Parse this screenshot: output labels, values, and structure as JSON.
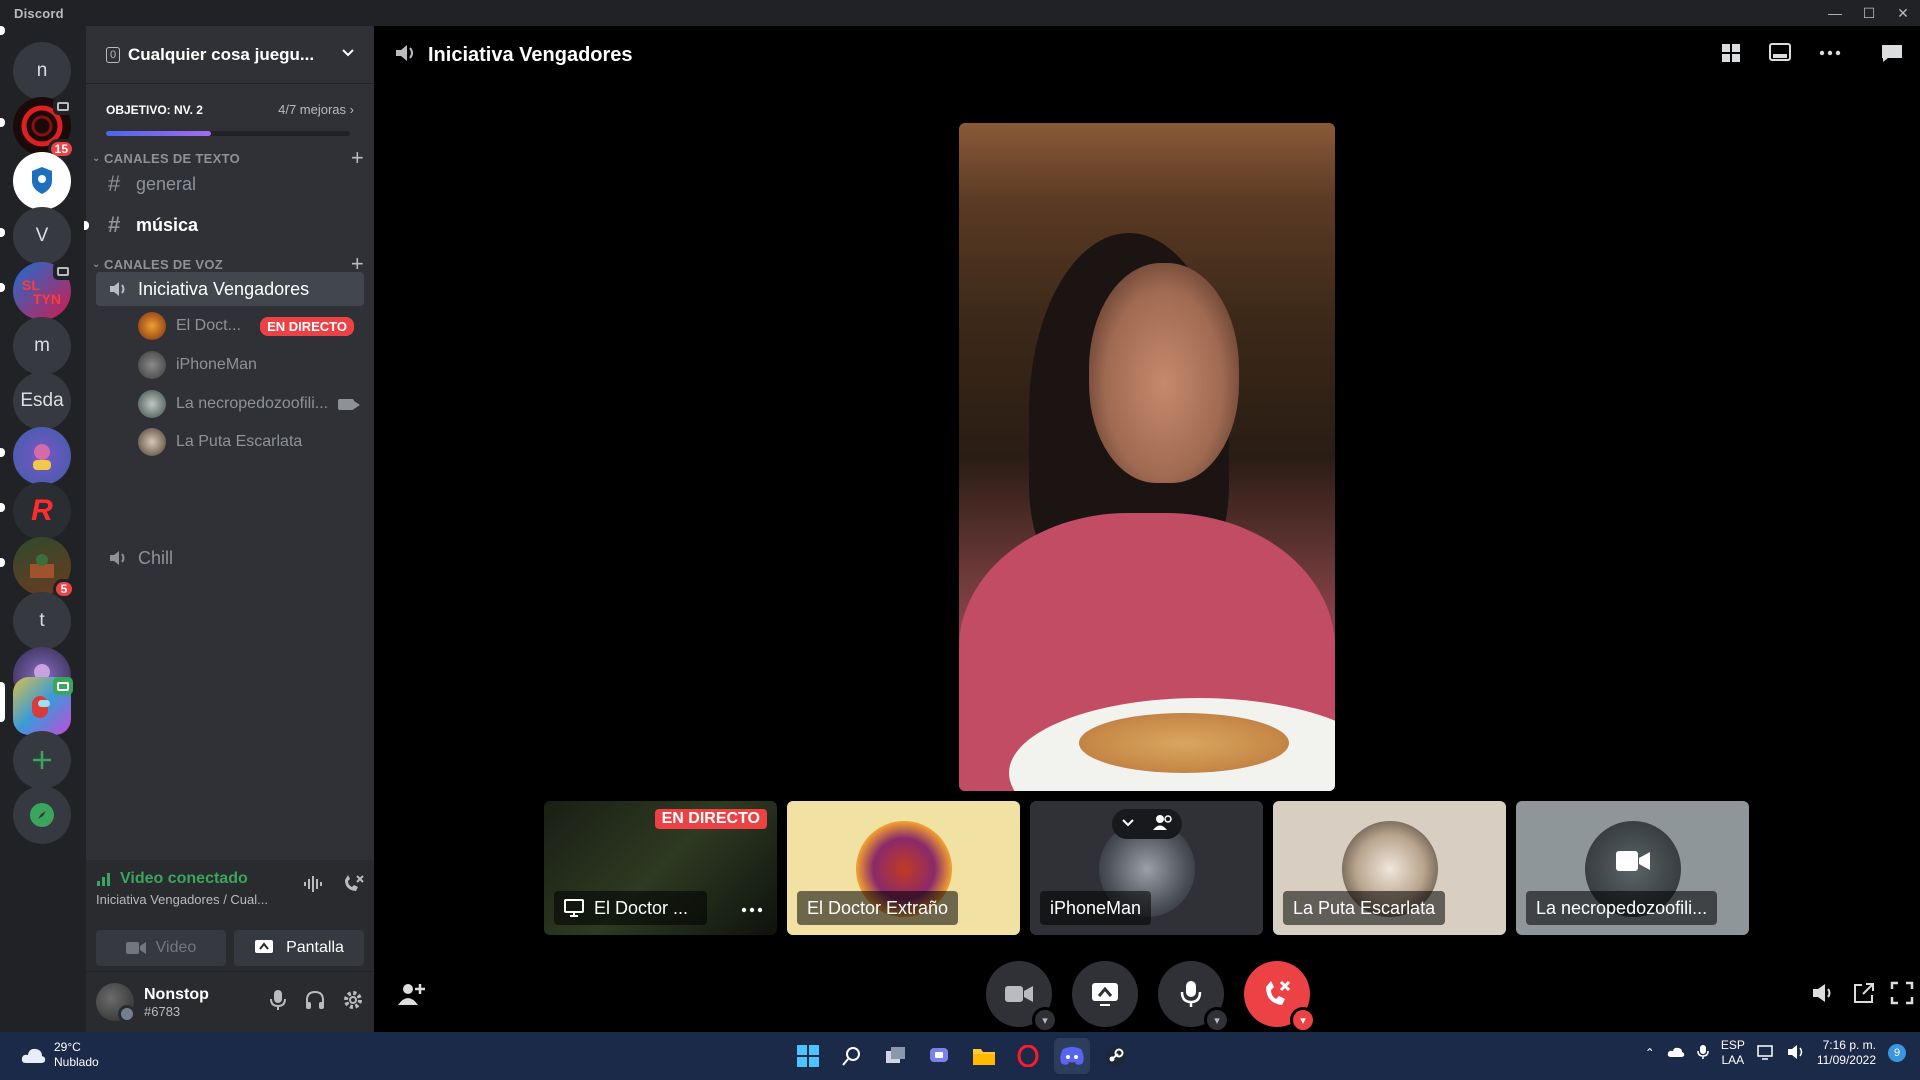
{
  "window": {
    "app_title": "Discord",
    "controls": [
      "—",
      "☐",
      "✕"
    ]
  },
  "servers": [
    {
      "id": "n",
      "label": "n"
    },
    {
      "id": "red-circle",
      "label": "",
      "badge": "15"
    },
    {
      "id": "citizen-security",
      "label": ""
    },
    {
      "id": "v",
      "label": "V"
    },
    {
      "id": "sltyn",
      "label": ""
    },
    {
      "id": "m",
      "label": "m"
    },
    {
      "id": "esda",
      "label": "Esda"
    },
    {
      "id": "purple-avatar",
      "label": ""
    },
    {
      "id": "r-logo",
      "label": "R"
    },
    {
      "id": "game-art",
      "label": "",
      "badge": "5"
    },
    {
      "id": "t",
      "label": "t"
    },
    {
      "id": "league-art",
      "label": ""
    },
    {
      "id": "among-us",
      "label": ""
    }
  ],
  "guild": {
    "boost_count": "0",
    "name": "Cualquier cosa juegu...",
    "goal_label": "OBJETIVO: NV. 2",
    "goal_progress": "4/7 mejoras",
    "goal_fraction": 0.43
  },
  "text_category": "CANALES DE TEXTO",
  "text_channels": [
    "general",
    "música"
  ],
  "voice_category": "CANALES DE VOZ",
  "voice_channels": [
    "Iniciativa Vengadores",
    "Chill"
  ],
  "voice_users": [
    {
      "name": "El Doct...",
      "live": "EN DIRECTO"
    },
    {
      "name": "iPhoneMan"
    },
    {
      "name": "La necropedozoofili..."
    },
    {
      "name": "La Puta Escarlata"
    }
  ],
  "rtc": {
    "status": "Video conectado",
    "location": "Iniciativa Vengadores / Cual...",
    "video_button": "Video",
    "screen_button": "Pantalla"
  },
  "user": {
    "name": "Nonstop",
    "tag": "#6783"
  },
  "main": {
    "channel_title": "Iniciativa Vengadores"
  },
  "tiles": [
    {
      "label": "El Doctor ...",
      "live": "EN DIRECTO"
    },
    {
      "label": "El Doctor Extraño"
    },
    {
      "label": "iPhoneMan"
    },
    {
      "label": "La Puta Escarlata"
    },
    {
      "label": "La necropedozoofili..."
    }
  ],
  "taskbar": {
    "temp": "29°C",
    "weather": "Nublado",
    "lang_top": "ESP",
    "lang_bottom": "LAA",
    "time": "7:16 p. m.",
    "date": "11/09/2022",
    "notifications": "9"
  },
  "colors": {
    "accent": "#5865f2",
    "live_red": "#ed4245",
    "connected_green": "#3ba55d",
    "rail_bg": "#202225",
    "sidebar_bg": "#2f3136"
  }
}
